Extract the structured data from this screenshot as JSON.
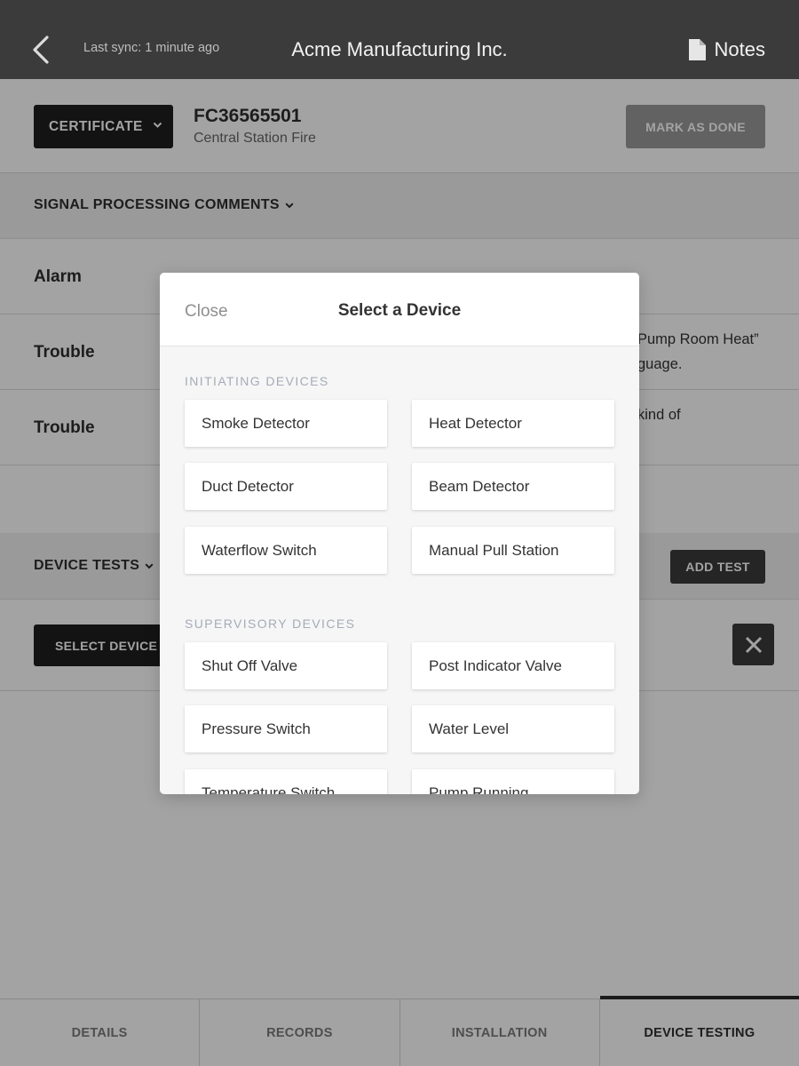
{
  "topbar": {
    "sync_text": "Last sync: 1 minute ago",
    "title": "Acme Manufacturing Inc.",
    "notes_label": "Notes"
  },
  "certificate": {
    "button_label": "CERTIFICATE",
    "id": "FC36565501",
    "subtitle": "Central Station Fire",
    "mark_done_label": "MARK AS DONE"
  },
  "signal_section": {
    "title": "SIGNAL PROCESSING COMMENTS",
    "rows": [
      {
        "label": "Alarm",
        "text_line1": "",
        "text_line2": ""
      },
      {
        "label": "Trouble",
        "text_line1": "Pump Room Heat”",
        "text_line2": "guage."
      },
      {
        "label": "Trouble",
        "text_line1": "kind of",
        "text_line2": ""
      }
    ]
  },
  "device_tests": {
    "title": "DEVICE TESTS",
    "add_test_label": "ADD TEST",
    "select_type_label": "SELECT DEVICE TY"
  },
  "tabs": [
    {
      "label": "DETAILS",
      "active": false
    },
    {
      "label": "RECORDS",
      "active": false
    },
    {
      "label": "INSTALLATION",
      "active": false
    },
    {
      "label": "DEVICE TESTING",
      "active": true
    }
  ],
  "modal": {
    "close_label": "Close",
    "title": "Select a Device",
    "groups": [
      {
        "title": "INITIATING DEVICES",
        "devices": [
          "Smoke Detector",
          "Heat Detector",
          "Duct Detector",
          "Beam Detector",
          "Waterflow Switch",
          "Manual Pull Station"
        ]
      },
      {
        "title": "SUPERVISORY DEVICES",
        "devices": [
          "Shut Off Valve",
          "Post Indicator Valve",
          "Pressure Switch",
          "Water Level",
          "Temperature Switch",
          "Pump Running"
        ]
      }
    ]
  },
  "colors": {
    "topbar_bg": "#3b3b3b",
    "dark_button": "#1f1f1f",
    "group_title": "#a6abb8"
  }
}
